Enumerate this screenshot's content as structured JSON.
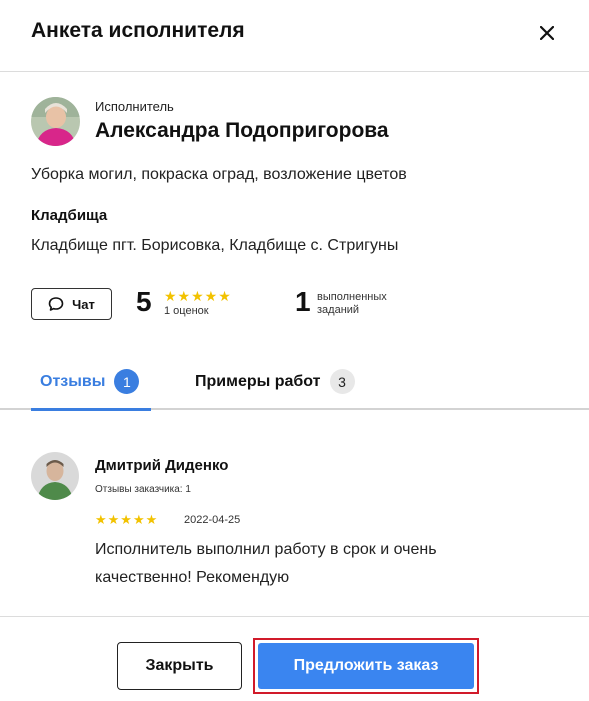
{
  "header": {
    "title": "Анкета исполнителя",
    "close_icon": "close-icon"
  },
  "performer": {
    "role_label": "Исполнитель",
    "name": "Александра Подопригорова",
    "services": "Уборка могил, покраска оград, возложение цветов",
    "cemeteries_title": "Кладбища",
    "cemeteries": "Кладбище пгт. Борисовка, Кладбище с. Стригуны"
  },
  "stats": {
    "chat_label": "Чат",
    "rating": "5",
    "rating_stars": "★★★★★",
    "rating_count": "1 оценок",
    "jobs_done": "1",
    "jobs_label": "выполненных заданий"
  },
  "tabs": [
    {
      "label": "Отзывы",
      "count": "1",
      "active": true
    },
    {
      "label": "Примеры работ",
      "count": "3",
      "active": false
    }
  ],
  "review": {
    "author": "Дмитрий Диденко",
    "author_meta": "Отзывы заказчика: 1",
    "stars": "★★★★★",
    "date": "2022-04-25",
    "text": "Исполнитель выполнил работу в срок и очень качественно! Рекомендую"
  },
  "footer": {
    "close_label": "Закрыть",
    "offer_label": "Предложить заказ"
  },
  "colors": {
    "accent": "#3a7ee0",
    "star": "#f2c200",
    "highlight_border": "#d11a2a"
  }
}
